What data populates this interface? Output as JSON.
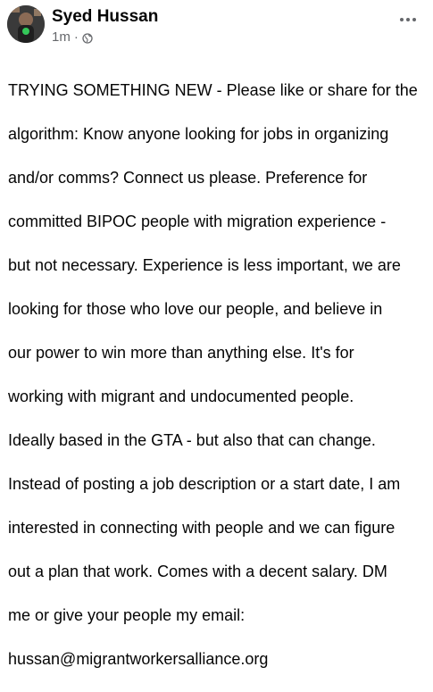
{
  "post": {
    "author_name": "Syed Hussan",
    "timestamp": "1m",
    "separator": "·",
    "audience_icon": "globe-icon",
    "more_icon": "more-options-icon",
    "body_lines": [
      "TRYING SOMETHING NEW - Please like or share for the",
      "algorithm: Know anyone looking for jobs in organizing",
      "and/or comms? Connect us please. Preference for",
      "committed BIPOC people with migration experience -",
      "but not necessary. Experience is less important, we are",
      "looking for those who love our people, and believe in",
      "our power to win more than anything else. It's for",
      "working with migrant and undocumented people.",
      "Ideally based in the GTA - but also that can change.",
      "Instead of posting a job description or a start date, I am",
      "interested in connecting with people and we can figure",
      "out a plan that work. Comes with a decent salary. DM",
      "me or give your people my email:",
      "hussan@migrantworkersalliance.org"
    ]
  },
  "colors": {
    "text_primary": "#050505",
    "text_secondary": "#65676b",
    "background": "#ffffff"
  }
}
